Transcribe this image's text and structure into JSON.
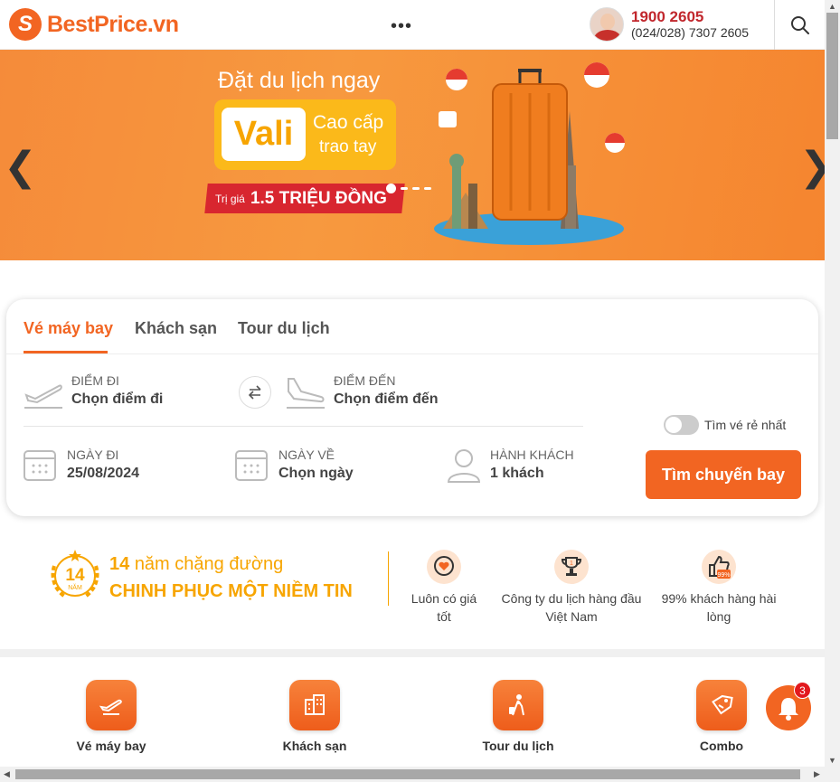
{
  "header": {
    "brand": "BestPrice.vn",
    "more": "•••",
    "hotline_main": "1900 2605",
    "hotline_sub": "(024/028) 7307 2605"
  },
  "banner": {
    "headline": "Đặt du lịch ngay",
    "vali": "Vali",
    "vali_line1": "Cao cấp",
    "vali_line2": "trao tay",
    "price_prefix": "Trị giá",
    "price_value": "1.5 TRIỆU ĐỒNG",
    "prev": "❮",
    "next": "❯"
  },
  "search": {
    "tabs": [
      "Vé máy bay",
      "Khách sạn",
      "Tour du lịch"
    ],
    "from_label": "Điểm đi",
    "from_value": "Chọn điểm đi",
    "to_label": "Điểm đến",
    "to_value": "Chọn điểm đến",
    "depart_label": "Ngày đi",
    "depart_value": "25/08/2024",
    "return_label": "Ngày về",
    "return_value": "Chọn ngày",
    "pax_label": "Hành khách",
    "pax_value": "1 khách",
    "cheapest_toggle": "Tìm vé rẻ nhất",
    "submit": "Tìm chuyến bay"
  },
  "trust": {
    "laurel_number": "14",
    "laurel_word": "NĂM",
    "years_num": "14",
    "years_text": "năm chặng đường",
    "slogan": "CHINH PHỤC MỘT NIỀM TIN",
    "usps": [
      "Luôn có giá tốt",
      "Công ty du lịch hàng đầu Việt Nam",
      "99% khách hàng hài lòng"
    ],
    "badge_99": "99%"
  },
  "quick_nav": [
    "Vé máy bay",
    "Khách sạn",
    "Tour du lịch",
    "Combo"
  ],
  "notifications": {
    "count": "3"
  },
  "colors": {
    "brand": "#f26522",
    "gold": "#f7a500",
    "hotline": "#c1272d"
  }
}
